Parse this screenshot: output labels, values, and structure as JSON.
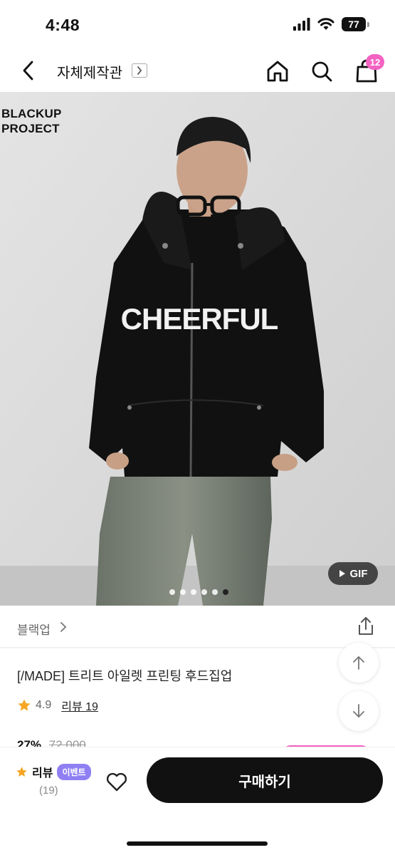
{
  "status": {
    "time": "4:48",
    "battery": "77",
    "icons": [
      "cellular-signal-icon",
      "wifi-icon",
      "battery-icon"
    ]
  },
  "nav": {
    "title": "자체제작관",
    "cart_count": "12",
    "icons": [
      "back-arrow-icon",
      "chevron-right-box-icon",
      "home-icon",
      "search-icon",
      "shopping-bag-icon"
    ]
  },
  "image": {
    "brand_logo_line1": "BLACKUP",
    "brand_logo_line2": "PROJECT",
    "shirt_text": "CHEERFUL",
    "gif_label": "GIF",
    "dots_total": 6,
    "dots_active_index": 5
  },
  "product": {
    "brand": "블랙업",
    "title": "[/MADE] 트리트 아일렛 프린팅 후드집업",
    "rating": "4.9",
    "review_link": "리뷰 19",
    "discount": "27%",
    "original_price": "72,000"
  },
  "bottom": {
    "review_label": "리뷰",
    "event_badge": "이벤트",
    "review_count": "(19)",
    "buy_label": "구매하기"
  },
  "colors": {
    "accent_pink": "#f462c2",
    "event_purple": "#8f7ff3",
    "star_orange": "#f5a623",
    "buy_button": "#111111"
  }
}
